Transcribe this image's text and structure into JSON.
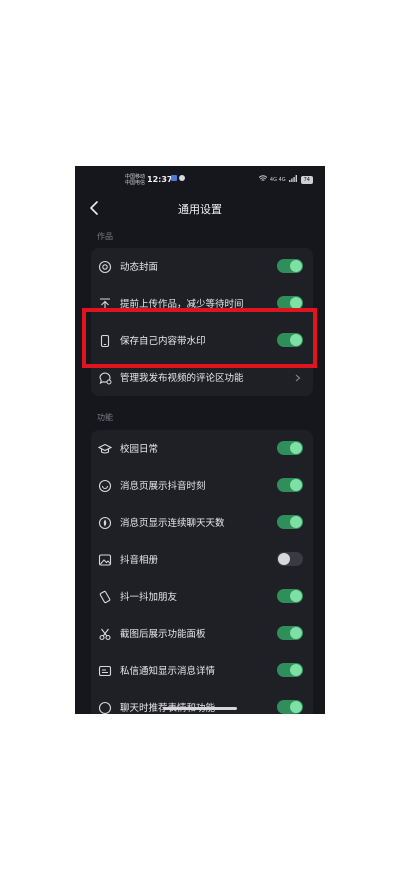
{
  "status_bar": {
    "carrier_line1": "中国移动",
    "carrier_line2": "中国电信",
    "time": "12:37",
    "right_text": "4G 4G",
    "battery": "74"
  },
  "header": {
    "title": "通用设置"
  },
  "sections": [
    {
      "label": "作品",
      "items": [
        {
          "label": "动态封面",
          "icon": "target-icon",
          "control": "toggle",
          "state": "on"
        },
        {
          "label": "提前上传作品，减少等待时间",
          "icon": "upload-icon",
          "control": "toggle",
          "state": "on"
        },
        {
          "label": "保存自己内容带水印",
          "icon": "phone-icon",
          "control": "toggle",
          "state": "on"
        },
        {
          "label": "管理我发布视频的评论区功能",
          "icon": "comment-settings-icon",
          "control": "chevron"
        }
      ]
    },
    {
      "label": "功能",
      "items": [
        {
          "label": "校园日常",
          "icon": "graduation-cap-icon",
          "control": "toggle",
          "state": "on"
        },
        {
          "label": "消息页展示抖音时刻",
          "icon": "moment-icon",
          "control": "toggle",
          "state": "on"
        },
        {
          "label": "消息页显示连续聊天天数",
          "icon": "fire-icon",
          "control": "toggle",
          "state": "on"
        },
        {
          "label": "抖音相册",
          "icon": "album-icon",
          "control": "toggle",
          "state": "off"
        },
        {
          "label": "抖一抖加朋友",
          "icon": "shake-phone-icon",
          "control": "toggle",
          "state": "on"
        },
        {
          "label": "截图后展示功能面板",
          "icon": "scissors-icon",
          "control": "toggle",
          "state": "on"
        },
        {
          "label": "私信通知显示消息详情",
          "icon": "message-card-icon",
          "control": "toggle",
          "state": "on"
        },
        {
          "label": "聊天时推荐表情和功能",
          "icon": "emoji-icon",
          "control": "toggle",
          "state": "on"
        }
      ]
    }
  ],
  "colors": {
    "toggle_on": "#2f8f5b",
    "knob_on": "#7ee0a4",
    "highlight": "#e0141e",
    "background": "#16171c"
  }
}
